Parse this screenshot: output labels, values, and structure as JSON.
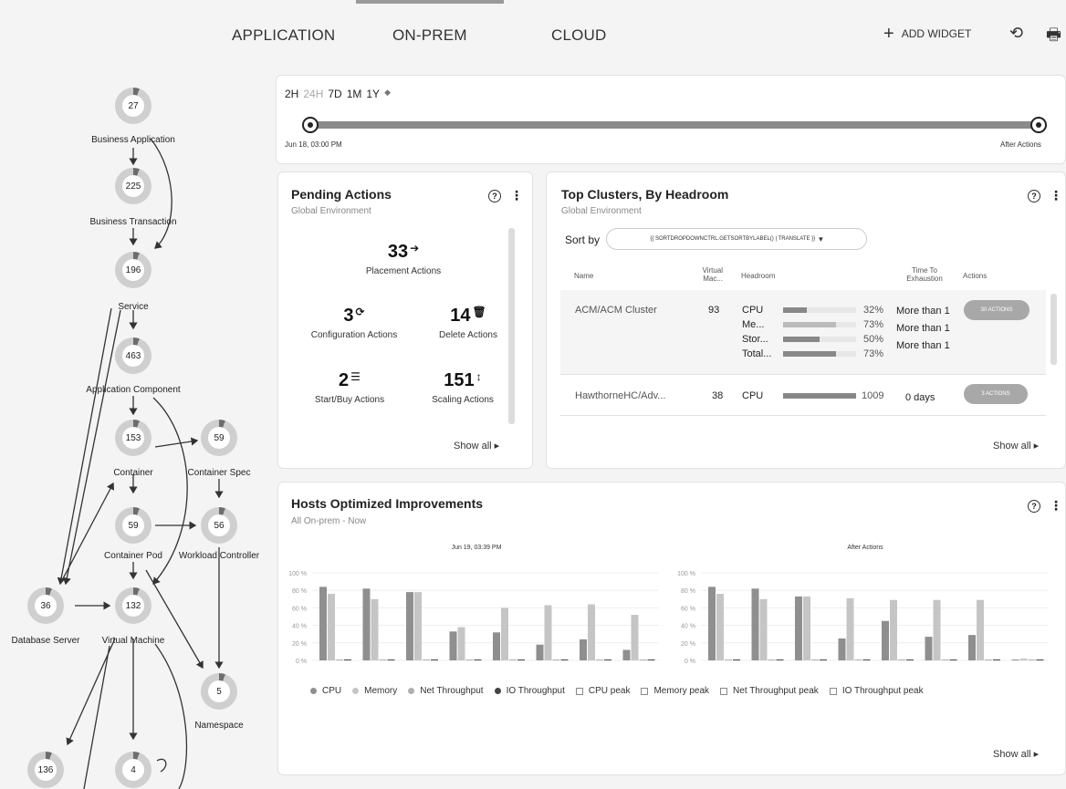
{
  "nav": {
    "tabs": [
      "APPLICATION",
      "ON-PREM",
      "CLOUD"
    ],
    "add_widget": "ADD WIDGET",
    "plus_icon": "+",
    "history_icon": "⟲",
    "print_icon": "🖶"
  },
  "supply_chain": {
    "nodes": [
      {
        "id": "business-application",
        "count": "27",
        "label": "Business Application"
      },
      {
        "id": "business-transaction",
        "count": "225",
        "label": "Business Transaction"
      },
      {
        "id": "service",
        "count": "196",
        "label": "Service"
      },
      {
        "id": "application-component",
        "count": "463",
        "label": "Application Component"
      },
      {
        "id": "container",
        "count": "153",
        "label": "Container"
      },
      {
        "id": "container-spec",
        "count": "59",
        "label": "Container Spec"
      },
      {
        "id": "container-pod",
        "count": "59",
        "label": "Container Pod"
      },
      {
        "id": "workload-controller",
        "count": "56",
        "label": "Workload Controller"
      },
      {
        "id": "database-server",
        "count": "36",
        "label": "Database Server"
      },
      {
        "id": "virtual-machine",
        "count": "132",
        "label": "Virtual Machine"
      },
      {
        "id": "namespace",
        "count": "5",
        "label": "Namespace"
      },
      {
        "id": "bottom-left",
        "count": "136",
        "label": ""
      },
      {
        "id": "bottom-mid",
        "count": "4",
        "label": ""
      }
    ]
  },
  "timeline": {
    "ranges": [
      {
        "label": "2H",
        "muted": false
      },
      {
        "label": "24H",
        "muted": true
      },
      {
        "label": "7D",
        "muted": false
      },
      {
        "label": "1M",
        "muted": false
      },
      {
        "label": "1Y",
        "muted": false
      }
    ],
    "toggle_icon": "◆",
    "start_label": "Jun 18, 03:00 PM",
    "end_label": "After Actions"
  },
  "pending_actions": {
    "title": "Pending Actions",
    "subtitle": "Global Environment",
    "help_icon": "?",
    "menu_icon": "⋮",
    "items": [
      {
        "count": "33",
        "icon": "➔",
        "label": "Placement Actions"
      },
      {
        "count": "3",
        "icon": "⟳",
        "label": "Configuration Actions"
      },
      {
        "count": "14",
        "icon": "🗑",
        "label": "Delete Actions"
      },
      {
        "count": "2",
        "icon": "☰",
        "label": "Start/Buy Actions"
      },
      {
        "count": "151",
        "icon": "↕",
        "label": "Scaling Actions"
      }
    ],
    "show_all": "Show all ▸"
  },
  "top_clusters": {
    "title": "Top Clusters, By Headroom",
    "subtitle": "Global Environment",
    "help_icon": "?",
    "menu_icon": "⋮",
    "sort_by_label": "Sort by",
    "sort_value": "{{ SORTDROPDOWNCTRL.GETSORTBYLABEL() | TRANSLATE }}",
    "sort_caret": "▾",
    "columns": [
      "Name",
      "Virtual Mac...",
      "Headroom",
      "Time To Exhaustion",
      "Actions"
    ],
    "rows": [
      {
        "name": "ACM/ACM Cluster",
        "vms": "93",
        "headroom": [
          {
            "metric": "CPU",
            "percent": "32%",
            "value": 0.32
          },
          {
            "metric": "Me...",
            "percent": "73%",
            "value": 0.73
          },
          {
            "metric": "Stor...",
            "percent": "50%",
            "value": 0.5
          },
          {
            "metric": "Total...",
            "percent": "73%",
            "value": 0.73
          }
        ],
        "exhaustion": [
          "More than 1",
          "More than 1",
          "More than 1"
        ],
        "action": "30 ACTIONS"
      },
      {
        "name": "HawthorneHC/Adv...",
        "vms": "38",
        "headroom": [
          {
            "metric": "CPU",
            "percent": "1009",
            "value": 1.0
          }
        ],
        "exhaustion": [
          "0 days"
        ],
        "action": "3 ACTIONS"
      }
    ],
    "show_all": "Show all ▸"
  },
  "hosts_optimized": {
    "title": "Hosts Optimized Improvements",
    "subtitle": "All On-prem - Now",
    "help_icon": "?",
    "menu_icon": "⋮",
    "show_all": "Show all ▸"
  },
  "chart_data": [
    {
      "type": "bar",
      "title": "Jun 19, 03:39 PM",
      "yticks": [
        "100 %",
        "80 %",
        "60 %",
        "40 %",
        "20 %",
        "0 %"
      ],
      "ylim": [
        0,
        100
      ],
      "groups": 8,
      "series": [
        {
          "name": "CPU",
          "color": "#8f8f8f",
          "values": [
            84,
            82,
            78,
            33,
            32,
            18,
            24,
            12
          ]
        },
        {
          "name": "Memory",
          "color": "#c5c5c5",
          "values": [
            76,
            70,
            78,
            38,
            60,
            63,
            64,
            52
          ]
        },
        {
          "name": "Net Throughput",
          "color": "#b0b0b0",
          "values": [
            1,
            1,
            1,
            1,
            1,
            1,
            1,
            1
          ]
        },
        {
          "name": "IO Throughput",
          "color": "#444444",
          "values": [
            1,
            1,
            1,
            1,
            1,
            1,
            1,
            1
          ]
        }
      ]
    },
    {
      "type": "bar",
      "title": "After Actions",
      "yticks": [
        "100 %",
        "80 %",
        "60 %",
        "40 %",
        "20 %",
        "0 %"
      ],
      "ylim": [
        0,
        100
      ],
      "groups": 8,
      "series": [
        {
          "name": "CPU",
          "color": "#8f8f8f",
          "values": [
            84,
            82,
            73,
            25,
            45,
            27,
            29,
            1
          ]
        },
        {
          "name": "Memory",
          "color": "#c5c5c5",
          "values": [
            76,
            70,
            73,
            71,
            69,
            69,
            69,
            2
          ]
        },
        {
          "name": "Net Throughput",
          "color": "#b0b0b0",
          "values": [
            1,
            1,
            1,
            1,
            1,
            1,
            1,
            1
          ]
        },
        {
          "name": "IO Throughput",
          "color": "#444444",
          "values": [
            1,
            1,
            1,
            1,
            1,
            1,
            1,
            1
          ]
        }
      ]
    }
  ],
  "legend": [
    {
      "label": "CPU",
      "color": "#8f8f8f",
      "kind": "dot"
    },
    {
      "label": "Memory",
      "color": "#c5c5c5",
      "kind": "dot"
    },
    {
      "label": "Net Throughput",
      "color": "#b0b0b0",
      "kind": "dot"
    },
    {
      "label": "IO Throughput",
      "color": "#444444",
      "kind": "dot"
    },
    {
      "label": "CPU peak",
      "color": "#888888",
      "kind": "square"
    },
    {
      "label": "Memory peak",
      "color": "#888888",
      "kind": "square"
    },
    {
      "label": "Net Throughput peak",
      "color": "#888888",
      "kind": "square"
    },
    {
      "label": "IO Throughput peak",
      "color": "#888888",
      "kind": "square"
    }
  ]
}
